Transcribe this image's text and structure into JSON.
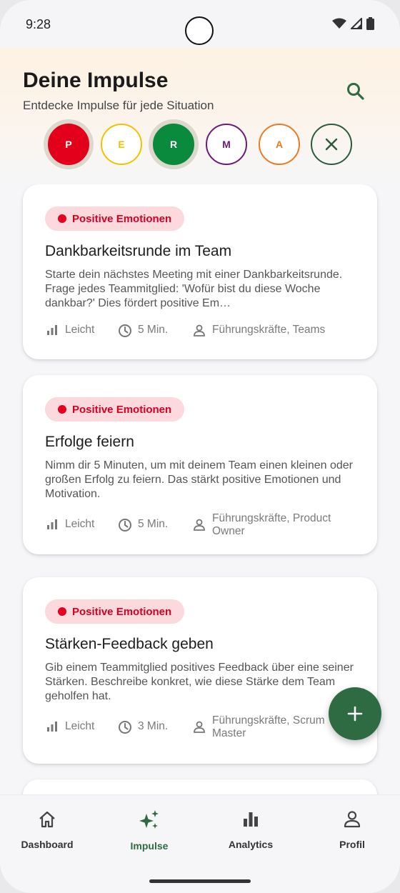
{
  "status_bar": {
    "time": "9:28"
  },
  "header": {
    "title": "Deine Impulse",
    "subtitle": "Entdecke Impulse für jede Situation"
  },
  "filters": [
    {
      "letter": "P",
      "color": "#e3001b",
      "selected": true
    },
    {
      "letter": "E",
      "color": "#f2c200",
      "selected": false
    },
    {
      "letter": "R",
      "color": "#0a8a3c",
      "selected": true
    },
    {
      "letter": "M",
      "color": "#6d1a78",
      "selected": false
    },
    {
      "letter": "A",
      "color": "#ee7a22",
      "selected": false
    }
  ],
  "cards": [
    {
      "category": "Positive Emotionen",
      "title": "Dankbarkeitsrunde im Team",
      "description": "Starte dein nächstes Meeting mit einer Dankbarkeitsrunde. Frage jedes Teammitglied: 'Wofür bist du diese Woche dankbar?' Dies fördert positive Em…",
      "difficulty": "Leicht",
      "duration": "5 Min.",
      "audience": "Führungskräfte, Teams"
    },
    {
      "category": "Positive Emotionen",
      "title": "Erfolge feiern",
      "description": "Nimm dir 5 Minuten, um mit deinem Team einen kleinen oder großen Erfolg zu feiern. Das stärkt positive Emotionen und Motivation.",
      "difficulty": "Leicht",
      "duration": "5 Min.",
      "audience": "Führungskräfte, Product Owner"
    },
    {
      "category": "Positive Emotionen",
      "title": "Stärken-Feedback geben",
      "description": "Gib einem Teammitglied positives Feedback über eine seiner Stärken. Beschreibe konkret, wie diese Stärke dem Team geholfen hat.",
      "difficulty": "Leicht",
      "duration": "3 Min.",
      "audience": "Führungskräfte, Scrum Master"
    }
  ],
  "nav": {
    "items": [
      {
        "label": "Dashboard",
        "icon": "home-icon"
      },
      {
        "label": "Impulse",
        "icon": "sparkles-icon"
      },
      {
        "label": "Analytics",
        "icon": "bar-chart-icon"
      },
      {
        "label": "Profil",
        "icon": "person-icon"
      }
    ],
    "active": "Impulse"
  },
  "colors": {
    "brand_green": "#2e6b43",
    "tag_background": "#fbd9dc",
    "tag_text": "#d6001f"
  }
}
